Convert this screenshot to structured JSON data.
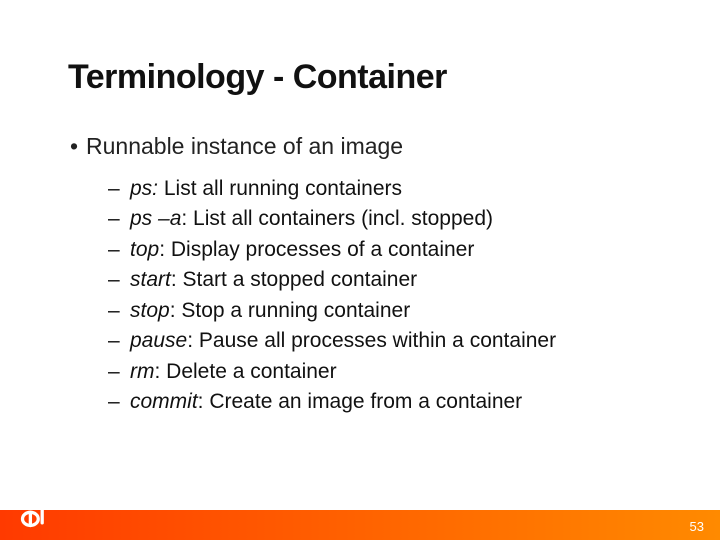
{
  "slide": {
    "title": "Terminology - Container",
    "bullet": "Runnable instance of an image",
    "items": [
      {
        "cmd": "ps:",
        "desc": " List all running containers"
      },
      {
        "cmd": "ps –a",
        "desc": ": List all containers (incl. stopped)"
      },
      {
        "cmd": "top",
        "desc": ": Display processes of a container"
      },
      {
        "cmd": "start",
        "desc": ": Start a stopped container"
      },
      {
        "cmd": "stop",
        "desc": ": Stop a running container"
      },
      {
        "cmd": "pause",
        "desc": ": Pause all processes within a container"
      },
      {
        "cmd": "rm",
        "desc": ": Delete a container"
      },
      {
        "cmd": "commit",
        "desc": ": Create an image from a container"
      }
    ],
    "page_number": "53"
  }
}
